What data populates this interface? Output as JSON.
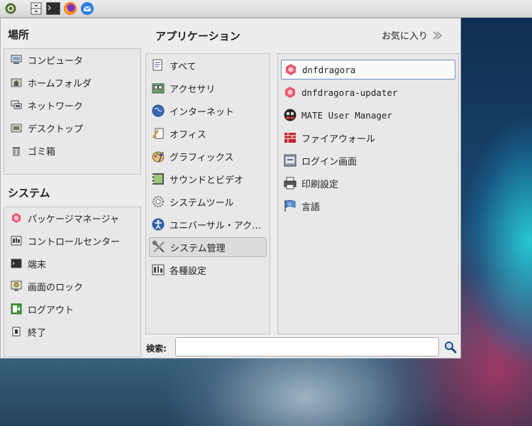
{
  "places": {
    "title": "場所",
    "items": [
      {
        "label": "コンピュータ",
        "icon": "computer-icon"
      },
      {
        "label": "ホームフォルダ",
        "icon": "home-folder-icon"
      },
      {
        "label": "ネットワーク",
        "icon": "network-icon"
      },
      {
        "label": "デスクトップ",
        "icon": "desktop-folder-icon"
      },
      {
        "label": "ゴミ箱",
        "icon": "trash-icon"
      }
    ]
  },
  "system": {
    "title": "システム",
    "items": [
      {
        "label": "パッケージマネージャ",
        "icon": "package-manager-icon"
      },
      {
        "label": "コントロールセンター",
        "icon": "control-center-icon"
      },
      {
        "label": "端末",
        "icon": "terminal-icon"
      },
      {
        "label": "画面のロック",
        "icon": "lock-screen-icon"
      },
      {
        "label": "ログアウト",
        "icon": "logout-icon"
      },
      {
        "label": "終了",
        "icon": "shutdown-icon"
      }
    ]
  },
  "applications": {
    "title": "アプリケーション",
    "favorites_label": "お気に入り",
    "categories": [
      {
        "label": "すべて",
        "icon": "all-icon"
      },
      {
        "label": "アクセサリ",
        "icon": "accessories-icon"
      },
      {
        "label": "インターネット",
        "icon": "internet-icon"
      },
      {
        "label": "オフィス",
        "icon": "office-icon"
      },
      {
        "label": "グラフィックス",
        "icon": "graphics-icon"
      },
      {
        "label": "サウンドとビデオ",
        "icon": "sound-video-icon"
      },
      {
        "label": "システムツール",
        "icon": "system-tools-icon"
      },
      {
        "label": "ユニバーサル・アク…",
        "icon": "universal-access-icon"
      },
      {
        "label": "システム管理",
        "icon": "administration-icon"
      },
      {
        "label": "各種設定",
        "icon": "preferences-icon"
      }
    ],
    "apps": [
      {
        "label": "dnfdragora",
        "icon": "dnfdragora-icon"
      },
      {
        "label": "dnfdragora-updater",
        "icon": "dnfdragora-updater-icon"
      },
      {
        "label": "MATE User Manager",
        "icon": "user-manager-icon"
      },
      {
        "label": "ファイアウォール",
        "icon": "firewall-icon"
      },
      {
        "label": "ログイン画面",
        "icon": "login-screen-icon"
      },
      {
        "label": "印刷設定",
        "icon": "printer-icon"
      },
      {
        "label": "言語",
        "icon": "language-icon"
      }
    ]
  },
  "search": {
    "label": "検索:",
    "value": ""
  },
  "colors": {
    "accent_border": "#6d8fc5",
    "dnfdragora": "#e8556f",
    "firewall": "#c0292b"
  }
}
